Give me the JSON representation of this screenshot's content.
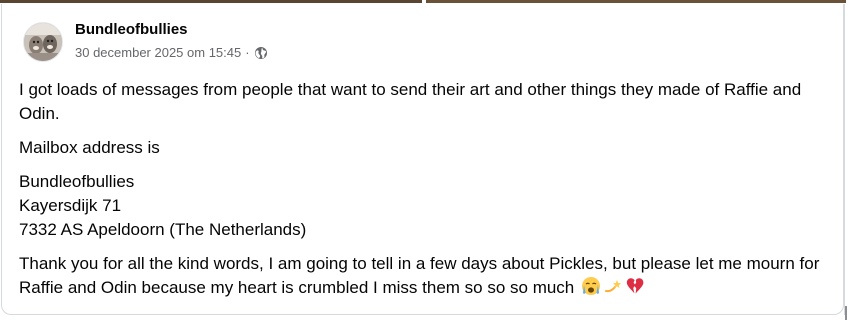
{
  "post": {
    "author": "Bundleofbullies",
    "timestamp": "30 december 2025 om 15:45",
    "separator": "·",
    "audience_icon": "globe-icon",
    "paragraph_1": "I got loads of messages from people that want to send their art and other things they made of Raffie and Odin.",
    "paragraph_2": "Mailbox address is",
    "address": {
      "line_1": "Bundleofbullies",
      "line_2": "Kayersdijk 71",
      "line_3": "7332 AS Apeldoorn (The Netherlands)"
    },
    "paragraph_4": "Thank you for all the kind words, I am going to tell in a few days about Pickles, but please let me mourn for Raffie and Odin because my heart is crumbled I miss them so so so much",
    "emojis": [
      "crying-face-emoji",
      "dizzy-emoji",
      "broken-heart-emoji"
    ]
  },
  "colors": {
    "text_primary": "#050505",
    "text_secondary": "#65676b",
    "card_border": "#d6d9dd",
    "broken_heart": "#e0245e"
  }
}
